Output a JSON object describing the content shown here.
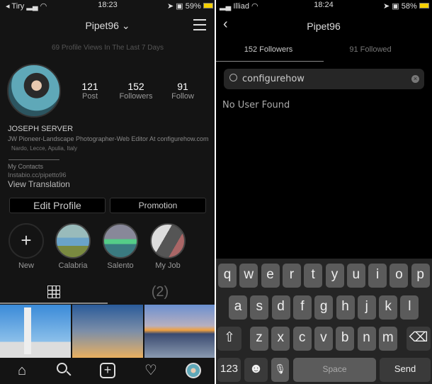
{
  "left": {
    "status": {
      "carrier": "Tiry",
      "time": "18:23",
      "battery": "59%"
    },
    "header": {
      "title": "Pipet96",
      "menu_icon": "hamburger-icon"
    },
    "profile_views": "69 Profile Views In The Last 7 Days",
    "stats": [
      {
        "value": "121",
        "label": "Post"
      },
      {
        "value": "152",
        "label": "Followers"
      },
      {
        "value": "91",
        "label": "Follow"
      }
    ],
    "name": "JOSEPH SERVER",
    "bio": "JW Pioneer-Landscape Photographer-Web Editor At configurehow.com",
    "location": "Nardo, Lecce, Apulia, Italy",
    "contacts": "My Contacts",
    "link": "Instabio.cc/pipetto96",
    "translation": "View Translation",
    "buttons": {
      "edit": "Edit Profile",
      "promotion": "Promotion"
    },
    "highlights": [
      {
        "label": "New"
      },
      {
        "label": "Calabria"
      },
      {
        "label": "Salento"
      },
      {
        "label": "My Job"
      }
    ],
    "tabs": {
      "grid_icon": "grid-icon",
      "tagged": "(2)"
    },
    "nav": [
      "home-icon",
      "search-icon",
      "add-icon",
      "heart-icon",
      "profile-avatar"
    ]
  },
  "right": {
    "status": {
      "carrier": "Illiad",
      "time": "18:24",
      "battery": "58%"
    },
    "header": {
      "title": "Pipet96"
    },
    "tabs": [
      {
        "label": "152 Followers",
        "active": true
      },
      {
        "label": "91 Followed",
        "active": false
      }
    ],
    "search": {
      "value": "configurehow"
    },
    "empty": "No User Found",
    "keyboard": {
      "row1": [
        "q",
        "w",
        "e",
        "r",
        "t",
        "y",
        "u",
        "i",
        "o",
        "p"
      ],
      "row2": [
        "a",
        "s",
        "d",
        "f",
        "g",
        "h",
        "j",
        "k",
        "l"
      ],
      "row3": [
        "z",
        "x",
        "c",
        "v",
        "b",
        "n",
        "m"
      ],
      "numbers": "123",
      "space": "Space",
      "send": "Send"
    }
  },
  "colors": {
    "bg_left": "#141414",
    "bg_right": "#000000",
    "key": "#5b5b5b",
    "keyboard": "#252525",
    "battery": "#f5d000"
  }
}
